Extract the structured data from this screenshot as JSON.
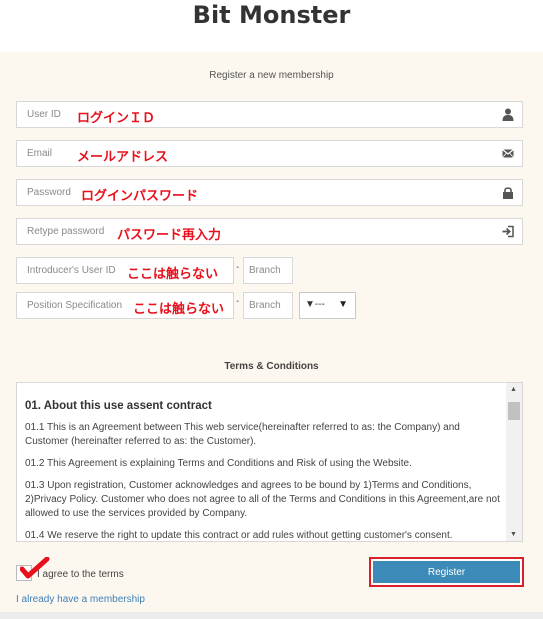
{
  "site": {
    "title": "Bit Monster"
  },
  "form": {
    "heading": "Register a new membership",
    "fields": {
      "user_id": {
        "placeholder": "User ID",
        "note": "ログインＩＤ",
        "icon": "user-icon"
      },
      "email": {
        "placeholder": "Email",
        "note": "メールアドレス",
        "icon": "envelope-icon"
      },
      "password": {
        "placeholder": "Password",
        "note": "ログインパスワード",
        "icon": "lock-icon"
      },
      "retype": {
        "placeholder": "Retype password",
        "note": "パスワード再入力",
        "icon": "sign-in-icon"
      },
      "introducer": {
        "placeholder": "Introducer's User ID",
        "note": "ここは触らない"
      },
      "position": {
        "placeholder": "Position Specification",
        "note": "ここは触らない"
      },
      "branch1": {
        "placeholder": "Branch"
      },
      "branch2": {
        "placeholder": "Branch"
      }
    },
    "dash": "-",
    "select": {
      "value": "▼---",
      "arrow": "▼"
    }
  },
  "terms": {
    "title": "Terms & Conditions",
    "heading": "01. About this use assent contract",
    "paragraphs": [
      "01.1 This is an Agreement between This web service(hereinafter referred to as: the Company) and Customer (hereinafter referred to as: the Customer).",
      "01.2 This Agreement is explaining Terms and Conditions and Risk of using the Website.",
      "01.3 Upon registration, Customer acknowledges and agrees to be bound by 1)Terms and Conditions, 2)Privacy Policy. Customer who does not agree to all of the Terms and Conditions in this Agreement,are not allowed to use the services provided by Company.",
      "01.4 We reserve the right to update this contract or add rules without getting customer's consent."
    ]
  },
  "agree": {
    "label": "I agree to the terms"
  },
  "register": {
    "label": "Register"
  },
  "login_link": {
    "label": "I already have a membership"
  },
  "colors": {
    "accent": "#3b8ab8",
    "annotation": "#e8101c",
    "panel": "#fdf8ef"
  }
}
